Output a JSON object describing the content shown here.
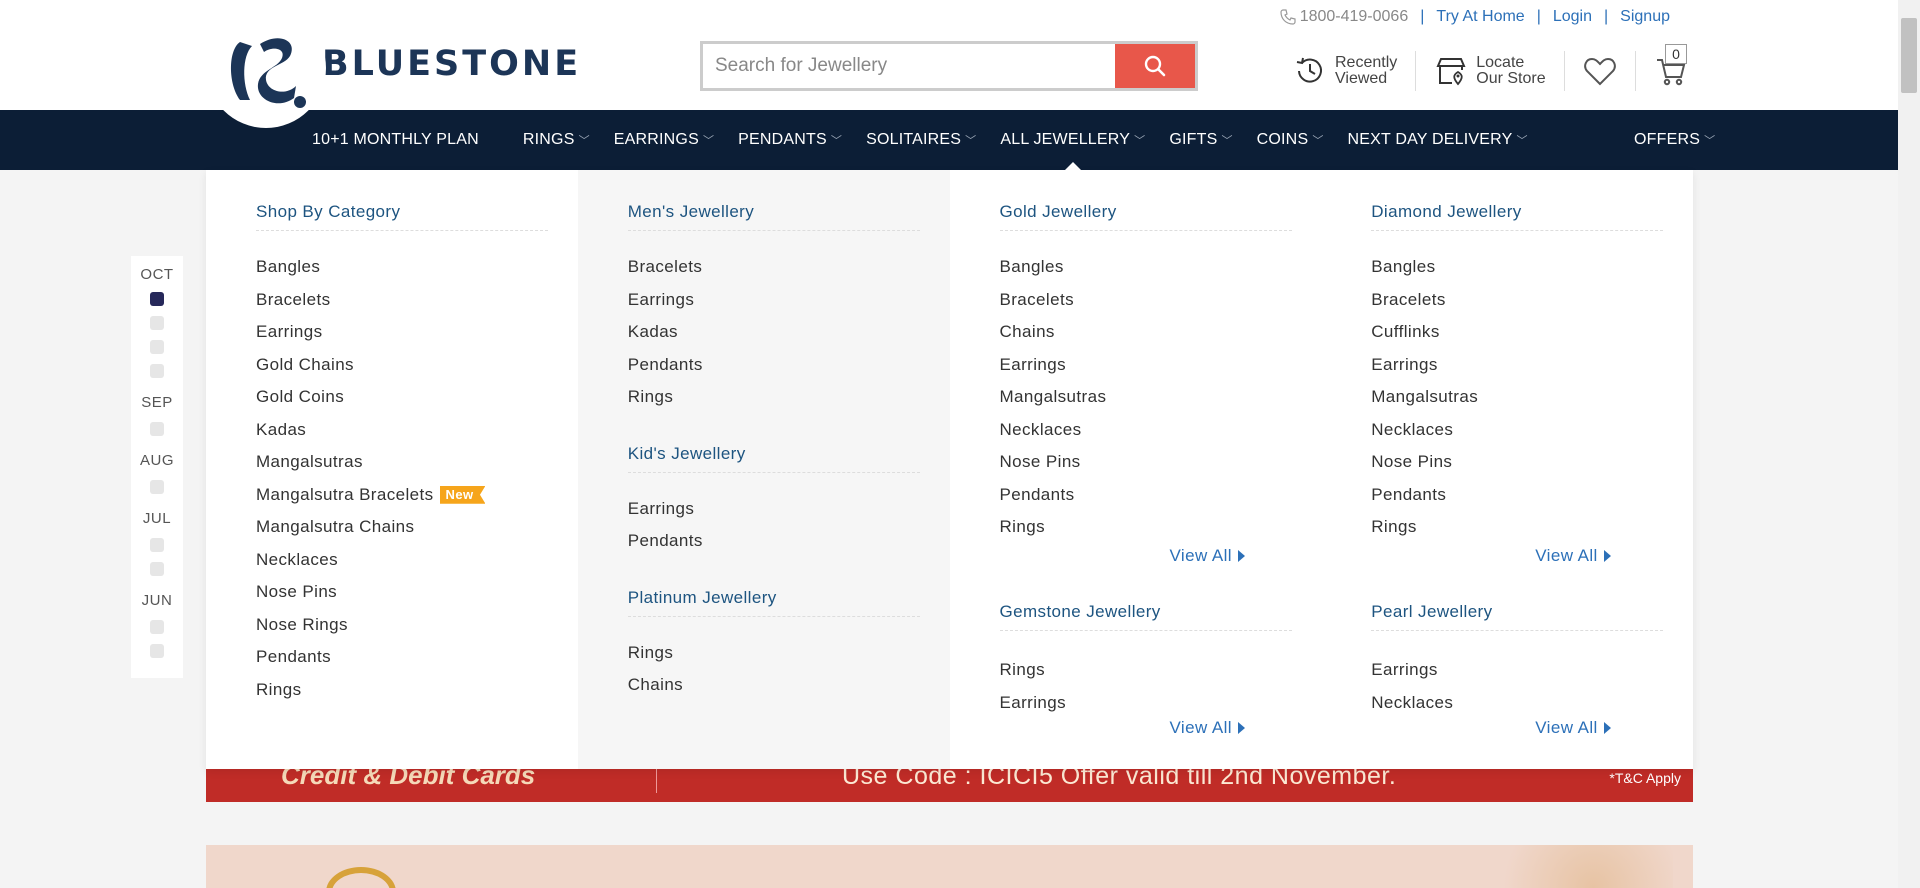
{
  "header": {
    "brand": "BLUESTONE",
    "phone": "1800-419-0066",
    "links": [
      "Try At Home",
      "Login",
      "Signup"
    ],
    "search_placeholder": "Search for Jewellery",
    "recently_viewed_l1": "Recently",
    "recently_viewed_l2": "Viewed",
    "locate_store_l1": "Locate",
    "locate_store_l2": "Our Store",
    "cart_count": "0"
  },
  "nav": {
    "items": [
      "10+1 MONTHLY PLAN",
      "RINGS",
      "EARRINGS",
      "PENDANTS",
      "SOLITAIRES",
      "ALL JEWELLERY",
      "GIFTS",
      "COINS",
      "NEXT DAY DELIVERY"
    ],
    "offers": "OFFERS",
    "active": "ALL JEWELLERY"
  },
  "timeline": {
    "months": [
      "OCT",
      "SEP",
      "AUG",
      "JUL",
      "JUN"
    ]
  },
  "menu": {
    "shop_by_category": {
      "title": "Shop By Category",
      "items": [
        "Bangles",
        "Bracelets",
        "Earrings",
        "Gold Chains",
        "Gold Coins",
        "Kadas",
        "Mangalsutras",
        "Mangalsutra Bracelets",
        "Mangalsutra Chains",
        "Necklaces",
        "Nose Pins",
        "Nose Rings",
        "Pendants",
        "Rings"
      ],
      "new_badge": "New"
    },
    "mens": {
      "title": "Men's Jewellery",
      "items": [
        "Bracelets",
        "Earrings",
        "Kadas",
        "Pendants",
        "Rings"
      ]
    },
    "kids": {
      "title": "Kid's Jewellery",
      "items": [
        "Earrings",
        "Pendants"
      ]
    },
    "platinum": {
      "title": "Platinum Jewellery",
      "items": [
        "Rings",
        "Chains"
      ]
    },
    "gold": {
      "title": "Gold Jewellery",
      "items": [
        "Bangles",
        "Bracelets",
        "Chains",
        "Earrings",
        "Mangalsutras",
        "Necklaces",
        "Nose Pins",
        "Pendants",
        "Rings"
      ]
    },
    "gemstone": {
      "title": "Gemstone Jewellery",
      "items": [
        "Rings",
        "Earrings"
      ]
    },
    "diamond": {
      "title": "Diamond Jewellery",
      "items": [
        "Bangles",
        "Bracelets",
        "Cufflinks",
        "Earrings",
        "Mangalsutras",
        "Necklaces",
        "Nose Pins",
        "Pendants",
        "Rings"
      ]
    },
    "pearl": {
      "title": "Pearl Jewellery",
      "items": [
        "Earrings",
        "Necklaces"
      ]
    },
    "view_all": "View All"
  },
  "banner": {
    "left": "Credit & Debit Cards",
    "code": "Use Code : ICICI5   Offer valid till 2nd November.",
    "tc": "*T&C Apply"
  },
  "colors": {
    "nav_bg": "#0c1e36",
    "accent": "#e8574a",
    "link": "#2c70b8",
    "badge": "#f6a51b"
  }
}
